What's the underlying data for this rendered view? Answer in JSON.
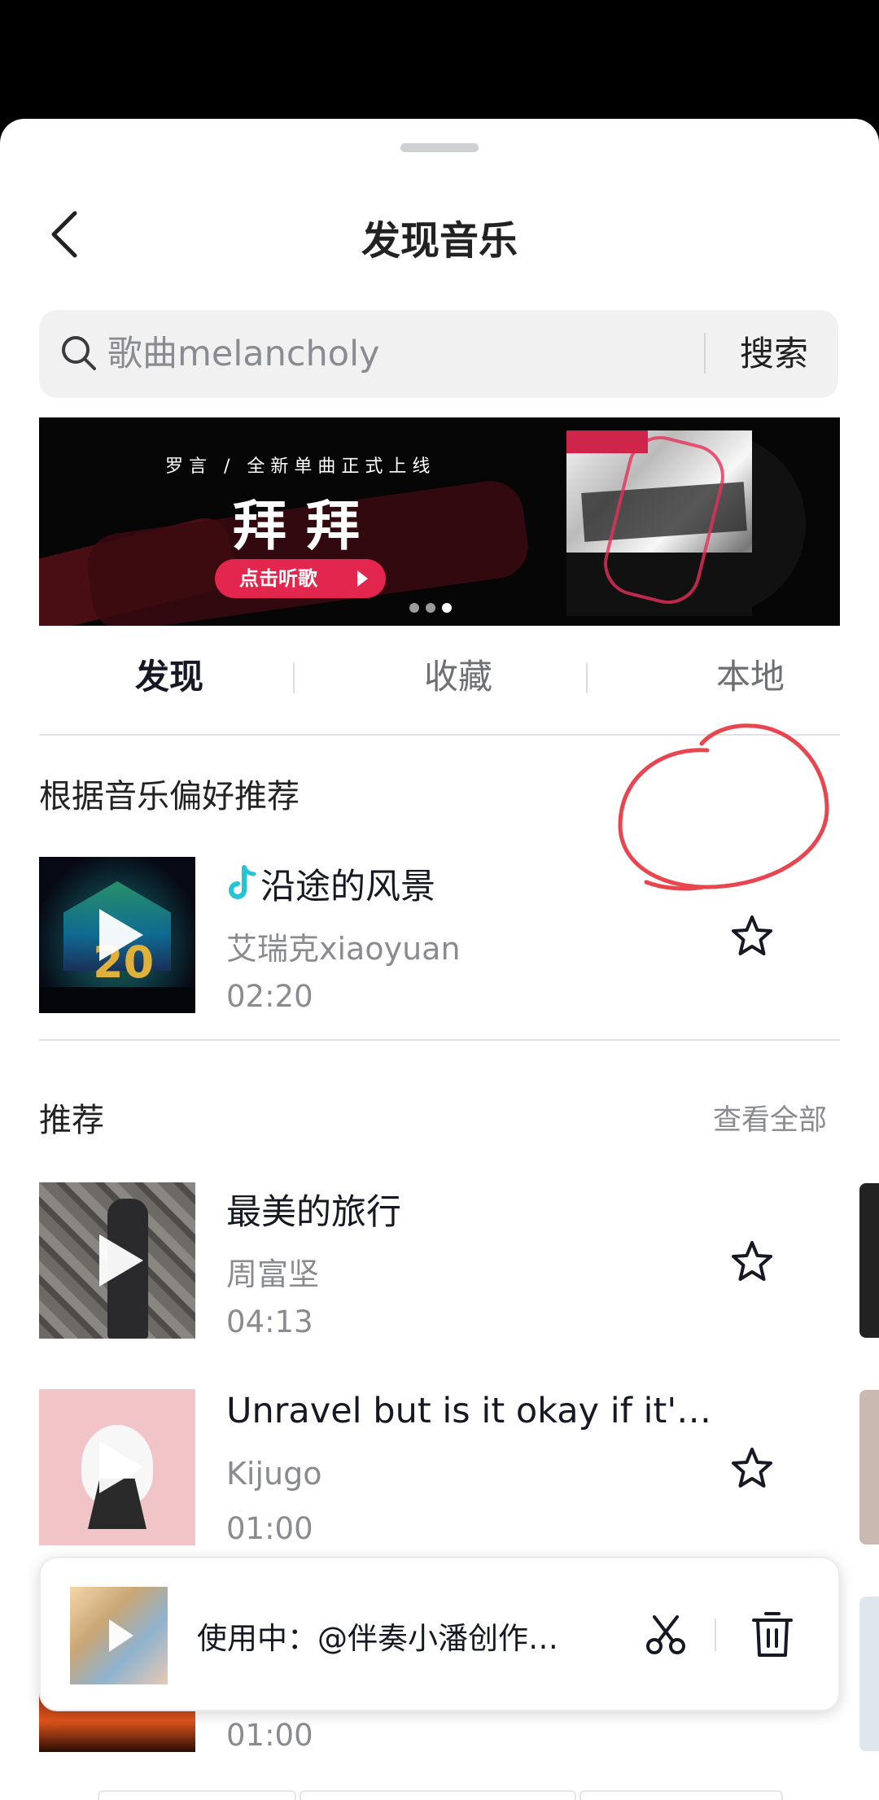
{
  "header": {
    "title": "发现音乐"
  },
  "search": {
    "placeholder": "歌曲melancholy",
    "button_label": "搜索"
  },
  "banner": {
    "subtitle": "罗言 / 全新单曲正式上线",
    "title": "拜拜",
    "cta": "点击听歌",
    "pages": 3,
    "active_page": 3
  },
  "tabs": [
    {
      "label": "发现",
      "active": true
    },
    {
      "label": "收藏",
      "active": false
    },
    {
      "label": "本地",
      "active": false
    }
  ],
  "preference": {
    "section_title": "根据音乐偏好推荐",
    "song": {
      "title": "沿途的风景",
      "artist": "艾瑞克xiaoyuan",
      "duration": "02:20"
    }
  },
  "recommend": {
    "section_title": "推荐",
    "see_all": "查看全部",
    "songs": [
      {
        "title": "最美的旅行",
        "artist": "周富坚",
        "duration": "04:13"
      },
      {
        "title": "Unravel but is it okay if it'…",
        "artist": "Kijugo",
        "duration": "01:00"
      },
      {
        "duration": "01:00"
      }
    ]
  },
  "now_playing": {
    "text": "使用中：@伴奏小潘创作…"
  },
  "colors": {
    "accent": "#e2264d",
    "annotation": "#e8454f",
    "tiktok_cyan": "#25c3d6"
  }
}
